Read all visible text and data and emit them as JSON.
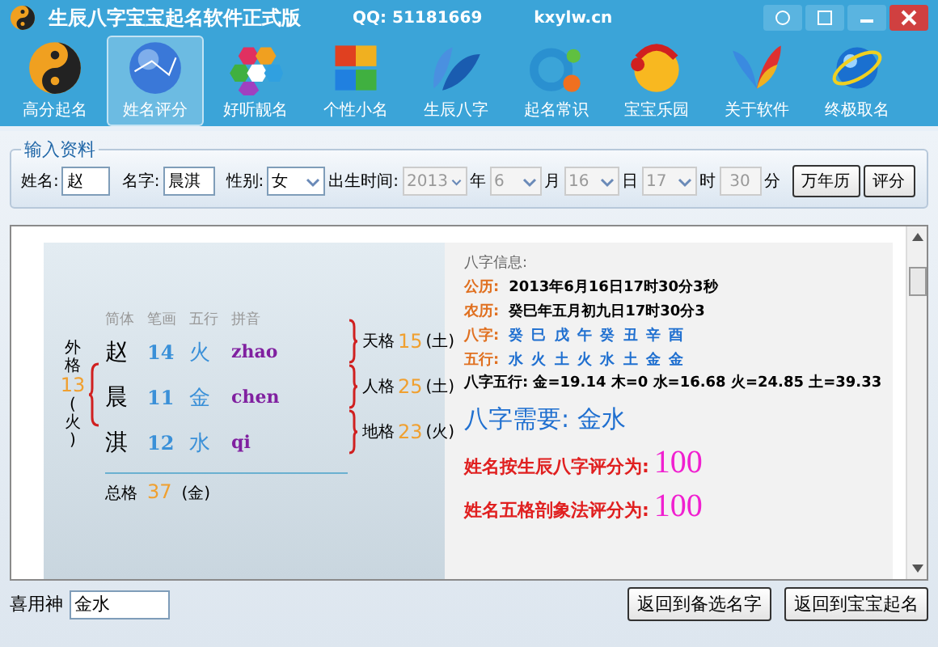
{
  "window": {
    "title": "生辰八字宝宝起名软件正式版",
    "qq": "QQ: 51181669",
    "site": "kxylw.cn"
  },
  "toolbar": [
    {
      "label": "高分起名",
      "selected": false
    },
    {
      "label": "姓名评分",
      "selected": true
    },
    {
      "label": "好听靓名",
      "selected": false
    },
    {
      "label": "个性小名",
      "selected": false
    },
    {
      "label": "生辰八字",
      "selected": false
    },
    {
      "label": "起名常识",
      "selected": false
    },
    {
      "label": "宝宝乐园",
      "selected": false
    },
    {
      "label": "关于软件",
      "selected": false
    },
    {
      "label": "终极取名",
      "selected": false
    }
  ],
  "input": {
    "legend": "输入资料",
    "surname_label": "姓名:",
    "surname": "赵",
    "given_label": "名字:",
    "given": "晨淇",
    "gender_label": "性别:",
    "gender": "女",
    "birth_label": "出生时间:",
    "year": "2013",
    "year_unit": "年",
    "month": "6",
    "month_unit": "月",
    "day": "16",
    "day_unit": "日",
    "hour": "17",
    "hour_unit": "时",
    "minute": "30",
    "minute_unit": "分",
    "buttons": [
      "万年历",
      "评分"
    ]
  },
  "grid": {
    "headers": [
      "简体",
      "笔画",
      "五行",
      "拼音"
    ],
    "rows": [
      {
        "char": "赵",
        "strokes": "14",
        "element": "火",
        "pinyin": "zhao"
      },
      {
        "char": "晨",
        "strokes": "11",
        "element": "金",
        "pinyin": "chen"
      },
      {
        "char": "淇",
        "strokes": "12",
        "element": "水",
        "pinyin": "qi"
      }
    ],
    "outer": {
      "label": "外格",
      "value": "13",
      "element": "(火)"
    },
    "right": [
      {
        "label": "天格",
        "value": "15",
        "element": "(土)"
      },
      {
        "label": "人格",
        "value": "25",
        "element": "(土)"
      },
      {
        "label": "地格",
        "value": "23",
        "element": "(火)"
      }
    ],
    "total": {
      "label": "总格",
      "value": "37",
      "element": "(金)"
    }
  },
  "bazi": {
    "heading": "八字信息:",
    "lines": [
      {
        "label": "公历:",
        "value": "2013年6月16日17时30分3秒",
        "kind": "plain"
      },
      {
        "label": "农历:",
        "value": "癸巳年五月初九日17时30分3",
        "kind": "plain"
      },
      {
        "label": "八字:",
        "value": "癸 巳 戊 午 癸 丑 辛 酉",
        "kind": "blue"
      },
      {
        "label": "五行:",
        "value": "水 火 土 火 水 土 金 金",
        "kind": "blue"
      }
    ],
    "stats": "八字五行: 金=19.14 木=0 水=16.68 火=24.85 土=39.33",
    "need": "八字需要: 金水",
    "scores": [
      {
        "label": "姓名按生辰八字评分为:",
        "value": "100"
      },
      {
        "label": "姓名五格剖象法评分为:",
        "value": "100"
      }
    ]
  },
  "footer": {
    "label": "喜用神",
    "value": "金水",
    "buttons": [
      "返回到备选名字",
      "返回到宝宝起名"
    ]
  }
}
